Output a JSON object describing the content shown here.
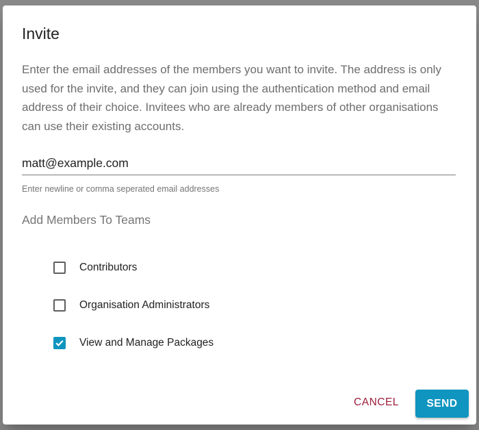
{
  "dialog": {
    "title": "Invite",
    "description": "Enter the email addresses of the members you want to invite. The address is only used for the invite, and they can join using the authentication method and email address of their choice. Invitees who are already members of other organisations can use their existing accounts.",
    "email": {
      "value": "matt@example.com",
      "helper": "Enter newline or comma seperated email addresses"
    },
    "teams_section_title": "Add Members To Teams",
    "teams": [
      {
        "label": "Contributors",
        "checked": false
      },
      {
        "label": "Organisation Administrators",
        "checked": false
      },
      {
        "label": "View and Manage Packages",
        "checked": true
      }
    ],
    "cancel_label": "CANCEL",
    "send_label": "SEND"
  },
  "colors": {
    "accent": "#0f95bf",
    "cancel": "#9c1f3c"
  }
}
